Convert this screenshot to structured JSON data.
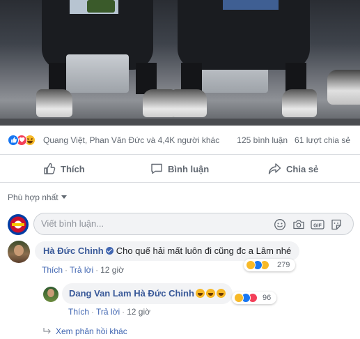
{
  "post": {
    "reactions": {
      "types": [
        "like-icon",
        "love-icon",
        "haha-icon"
      ],
      "names_text": "Quang Việt, Phan Văn Đức và 4,4K người khác",
      "comments_count": "125 bình luận",
      "shares_count": "61 lượt chia sẻ"
    },
    "actions": {
      "like_label": "Thích",
      "comment_label": "Bình luận",
      "share_label": "Chia sẻ"
    },
    "sort_label": "Phù hợp nhất",
    "comment_input_placeholder": "Viết bình luận..."
  },
  "comments": [
    {
      "author": "Hà Đức Chinh",
      "verified": true,
      "text": "Cho quế hải mất luôn đi cũng đc a Lâm nhé",
      "like_label": "Thích",
      "reply_label": "Trả lời",
      "time": "12 giờ",
      "reaction_count": "279",
      "reactions": [
        "haha-icon",
        "like-icon",
        "wow-icon"
      ]
    }
  ],
  "reply": {
    "author": "Dang Van Lam",
    "mention": "Hà Đức Chinh",
    "emojis": "😂😂😂",
    "like_label": "Thích",
    "reply_label": "Trả lời",
    "time": "12 giờ",
    "reaction_count": "96",
    "reactions": [
      "haha-icon",
      "like-icon",
      "love-icon"
    ]
  },
  "more_replies_label": "Xem phản hồi khác",
  "colors": {
    "link": "#385898",
    "like_blue": "#1877f2",
    "love_red": "#f33e58",
    "haha_yellow": "#f7b928",
    "secondary_text": "#606770",
    "divider": "#dadde1"
  }
}
